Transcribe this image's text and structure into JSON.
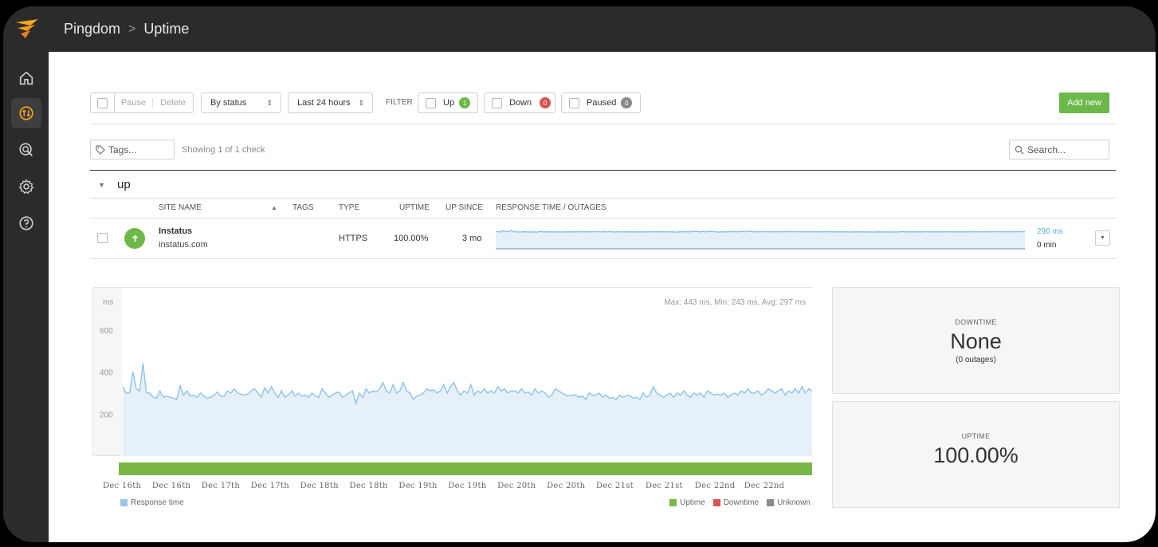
{
  "breadcrumb": {
    "app": "Pingdom",
    "separator": ">",
    "page": "Uptime"
  },
  "toolbar": {
    "pause": "Pause",
    "delete": "Delete",
    "sort_select": "By status",
    "range_select": "Last 24 hours",
    "filter_label": "FILTER",
    "filters": [
      {
        "label": "Up",
        "count": "1",
        "color": "#6cb849"
      },
      {
        "label": "Down",
        "count": "0",
        "color": "#d9534f"
      },
      {
        "label": "Paused",
        "count": "0",
        "color": "#888888"
      }
    ],
    "add_new": "Add new"
  },
  "tags_placeholder": "Tags...",
  "showing": "Showing 1 of 1 check",
  "search_placeholder": "Search...",
  "group": "up",
  "columns": [
    "SITE NAME",
    "TAGS",
    "TYPE",
    "UPTIME",
    "UP SINCE",
    "RESPONSE TIME / OUTAGES"
  ],
  "check": {
    "name": "Instatus",
    "url": "instatus.com",
    "type": "HTTPS",
    "uptime": "100.00%",
    "up_since": "3 mo",
    "response": "296 ms",
    "outage": "0 min"
  },
  "chart_data": {
    "type": "area",
    "ylabel": "ms",
    "y_ticks": [
      "600",
      "400",
      "200"
    ],
    "ylim": [
      0,
      800
    ],
    "stats": "Max: 443 ms, Min: 243 ms, Avg: 297 ms",
    "x_ticks": [
      "Dec 16th",
      "Dec 16th",
      "Dec 17th",
      "Dec 17th",
      "Dec 18th",
      "Dec 18th",
      "Dec 19th",
      "Dec 19th",
      "Dec 20th",
      "Dec 20th",
      "Dec 21st",
      "Dec 21st",
      "Dec 22nd",
      "Dec 22nd"
    ],
    "series": [
      {
        "name": "Response time",
        "color": "#8ec2ec",
        "values": [
          330,
          300,
          300,
          400,
          320,
          310,
          443,
          300,
          300,
          280,
          275,
          310,
          280,
          285,
          280,
          275,
          270,
          335,
          290,
          310,
          285,
          290,
          280,
          300,
          285,
          275,
          280,
          290,
          305,
          285,
          285,
          310,
          300,
          320,
          300,
          295,
          290,
          295,
          310,
          320,
          300,
          280,
          325,
          300,
          330,
          300,
          280,
          310,
          280,
          290,
          310,
          285,
          300,
          285,
          290,
          280,
          300,
          285,
          280,
          320,
          300,
          280,
          290,
          300,
          305,
          280,
          290,
          300,
          310,
          250,
          300,
          280,
          320,
          300,
          310,
          305,
          320,
          350,
          310,
          300,
          340,
          300,
          310,
          350,
          310,
          300,
          270,
          285,
          290,
          300,
          320,
          310,
          315,
          300,
          310,
          340,
          300,
          330,
          350,
          310,
          290,
          310,
          300,
          340,
          290,
          310,
          300,
          320,
          300,
          310,
          300,
          330,
          310,
          320,
          300,
          310,
          310,
          300,
          320,
          300,
          305,
          290,
          320,
          300,
          310,
          300,
          280,
          290,
          320,
          310,
          300,
          290,
          285,
          290,
          290,
          280,
          285,
          270,
          300,
          290,
          290,
          300,
          280,
          290,
          275,
          280,
          270,
          290,
          280,
          285,
          290,
          275,
          280,
          270,
          300,
          280,
          290,
          330,
          300,
          290,
          280,
          290,
          300,
          280,
          300,
          290,
          310,
          290,
          280,
          300,
          290,
          300,
          280,
          310,
          300,
          290,
          295,
          290,
          300,
          280,
          290,
          300,
          290,
          310,
          300,
          320,
          300,
          300,
          310,
          290,
          300,
          320,
          310,
          300,
          310,
          320,
          290,
          310,
          300,
          320,
          300,
          330,
          300,
          320,
          310
        ]
      }
    ],
    "status_bar": {
      "label": "Uptime",
      "color": "#7ab648"
    },
    "legend": [
      {
        "label": "Response time",
        "color": "#9ec7e8"
      },
      {
        "label": "Uptime",
        "color": "#7ab648"
      },
      {
        "label": "Downtime",
        "color": "#d9534f"
      },
      {
        "label": "Unknown",
        "color": "#8a8a8a"
      }
    ]
  },
  "downtime": {
    "caption": "DOWNTIME",
    "value": "None",
    "sub": "(0 outages)"
  },
  "uptime": {
    "caption": "UPTIME",
    "value": "100.00%"
  }
}
